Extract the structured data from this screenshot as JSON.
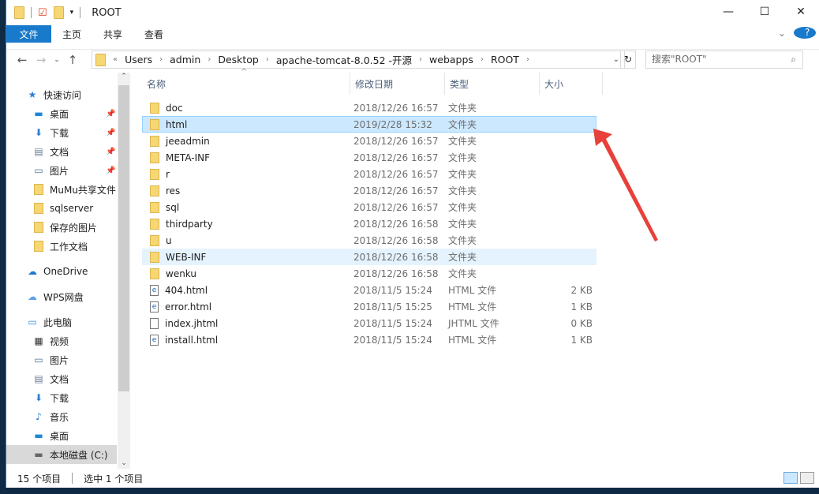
{
  "window": {
    "title": "ROOT"
  },
  "ribbon": {
    "file": "文件",
    "home": "主页",
    "share": "共享",
    "view": "查看"
  },
  "address": {
    "overflow": "«",
    "path": [
      "Users",
      "admin",
      "Desktop",
      "apache-tomcat-8.0.52 -开源",
      "webapps",
      "ROOT"
    ]
  },
  "search": {
    "placeholder": "搜索\"ROOT\""
  },
  "sidebar": {
    "items": [
      {
        "label": "快速访问",
        "icon": "star-icon",
        "level": 0
      },
      {
        "label": "桌面",
        "icon": "desktop-icon",
        "level": 1,
        "pinned": true
      },
      {
        "label": "下载",
        "icon": "download-icon",
        "level": 1,
        "pinned": true
      },
      {
        "label": "文档",
        "icon": "document-icon",
        "level": 1,
        "pinned": true
      },
      {
        "label": "图片",
        "icon": "pictures-icon",
        "level": 1,
        "pinned": true
      },
      {
        "label": "MuMu共享文件",
        "icon": "folder-icon",
        "level": 1
      },
      {
        "label": "sqlserver",
        "icon": "folder-icon",
        "level": 1
      },
      {
        "label": "保存的图片",
        "icon": "folder-icon",
        "level": 1
      },
      {
        "label": "工作文档",
        "icon": "folder-icon",
        "level": 1
      },
      {
        "label": "OneDrive",
        "icon": "cloud-icon",
        "level": 0
      },
      {
        "label": "WPS网盘",
        "icon": "cloud-outline-icon",
        "level": 0
      },
      {
        "label": "此电脑",
        "icon": "computer-icon",
        "level": 0
      },
      {
        "label": "视频",
        "icon": "video-icon",
        "level": 1
      },
      {
        "label": "图片",
        "icon": "pictures-icon",
        "level": 1
      },
      {
        "label": "文档",
        "icon": "document-icon",
        "level": 1
      },
      {
        "label": "下载",
        "icon": "download-icon",
        "level": 1
      },
      {
        "label": "音乐",
        "icon": "music-icon",
        "level": 1
      },
      {
        "label": "桌面",
        "icon": "desktop-icon",
        "level": 1
      },
      {
        "label": "本地磁盘 (C:)",
        "icon": "drive-icon",
        "level": 1,
        "selected": true
      }
    ]
  },
  "columns": {
    "name": "名称",
    "date": "修改日期",
    "type": "类型",
    "size": "大小"
  },
  "files": [
    {
      "name": "doc",
      "date": "2018/12/26 16:57",
      "type": "文件夹",
      "size": "",
      "kind": "folder"
    },
    {
      "name": "html",
      "date": "2019/2/28 15:32",
      "type": "文件夹",
      "size": "",
      "kind": "folder",
      "selected": true
    },
    {
      "name": "jeeadmin",
      "date": "2018/12/26 16:57",
      "type": "文件夹",
      "size": "",
      "kind": "folder"
    },
    {
      "name": "META-INF",
      "date": "2018/12/26 16:57",
      "type": "文件夹",
      "size": "",
      "kind": "folder"
    },
    {
      "name": "r",
      "date": "2018/12/26 16:57",
      "type": "文件夹",
      "size": "",
      "kind": "folder"
    },
    {
      "name": "res",
      "date": "2018/12/26 16:57",
      "type": "文件夹",
      "size": "",
      "kind": "folder"
    },
    {
      "name": "sql",
      "date": "2018/12/26 16:57",
      "type": "文件夹",
      "size": "",
      "kind": "folder"
    },
    {
      "name": "thirdparty",
      "date": "2018/12/26 16:58",
      "type": "文件夹",
      "size": "",
      "kind": "folder"
    },
    {
      "name": "u",
      "date": "2018/12/26 16:58",
      "type": "文件夹",
      "size": "",
      "kind": "folder"
    },
    {
      "name": "WEB-INF",
      "date": "2018/12/26 16:58",
      "type": "文件夹",
      "size": "",
      "kind": "folder",
      "hover": true
    },
    {
      "name": "wenku",
      "date": "2018/12/26 16:58",
      "type": "文件夹",
      "size": "",
      "kind": "folder"
    },
    {
      "name": "404.html",
      "date": "2018/11/5 15:24",
      "type": "HTML 文件",
      "size": "2 KB",
      "kind": "html"
    },
    {
      "name": "error.html",
      "date": "2018/11/5 15:25",
      "type": "HTML 文件",
      "size": "1 KB",
      "kind": "html"
    },
    {
      "name": "index.jhtml",
      "date": "2018/11/5 15:24",
      "type": "JHTML 文件",
      "size": "0 KB",
      "kind": "file"
    },
    {
      "name": "install.html",
      "date": "2018/11/5 15:24",
      "type": "HTML 文件",
      "size": "1 KB",
      "kind": "html"
    }
  ],
  "status": {
    "count": "15 个项目",
    "selected": "选中 1 个项目"
  },
  "colors": {
    "accent": "#1979ca",
    "selection": "#cce8ff",
    "arrow": "#e8403a"
  }
}
